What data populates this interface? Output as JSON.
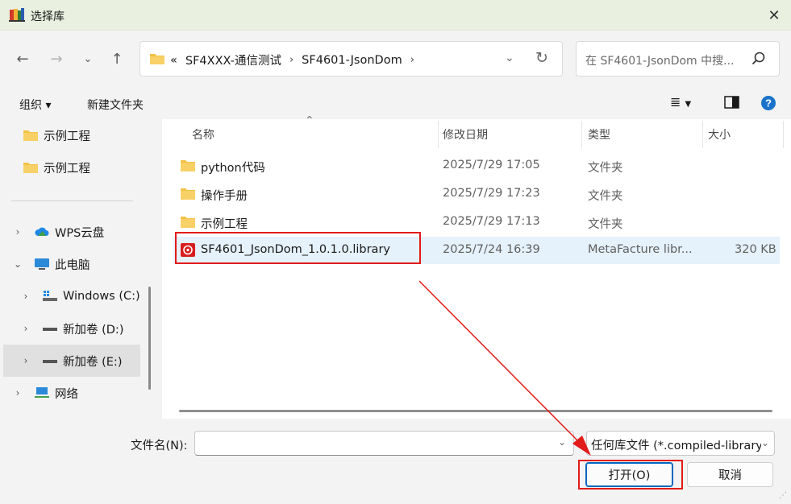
{
  "window": {
    "title": "选择库",
    "close_icon": "close-icon"
  },
  "nav": {
    "address_crumbs": [
      "«",
      "SF4XXX-通信测试",
      "SF4601-JsonDom"
    ],
    "search_placeholder": "在 SF4601-JsonDom 中搜..."
  },
  "toolbar": {
    "organize": "组织 ▾",
    "new_folder": "新建文件夹"
  },
  "sidebar": {
    "items": [
      {
        "label": "示例工程",
        "icon": "folder-icon"
      },
      {
        "label": "示例工程",
        "icon": "folder-icon"
      },
      {
        "label": "WPS云盘",
        "icon": "cloud-icon"
      },
      {
        "label": "此电脑",
        "icon": "computer-icon"
      },
      {
        "label": "Windows (C:)",
        "icon": "windows-drive-icon"
      },
      {
        "label": "新加卷 (D:)",
        "icon": "drive-icon"
      },
      {
        "label": "新加卷 (E:)",
        "icon": "drive-icon"
      },
      {
        "label": "网络",
        "icon": "network-icon"
      }
    ]
  },
  "file_list": {
    "columns": [
      "名称",
      "修改日期",
      "类型",
      "大小"
    ],
    "rows": [
      {
        "name": "python代码",
        "date": "2025/7/29 17:05",
        "type": "文件夹",
        "size": ""
      },
      {
        "name": "操作手册",
        "date": "2025/7/29 17:23",
        "type": "文件夹",
        "size": ""
      },
      {
        "name": "示例工程",
        "date": "2025/7/29 17:13",
        "type": "文件夹",
        "size": ""
      },
      {
        "name": "SF4601_JsonDom_1.0.1.0.library",
        "date": "2025/7/24 16:39",
        "type": "MetaFacture libr...",
        "size": "320 KB"
      }
    ]
  },
  "bottom": {
    "filename_label": "文件名(N):",
    "filename_value": "",
    "filter": "任何库文件 (*.compiled-library",
    "open_label": "打开(O)",
    "cancel_label": "取消"
  },
  "colors": {
    "annotation_red": "#e21b1b",
    "accent": "#0067c0",
    "selected_row": "#e5f1fb"
  }
}
